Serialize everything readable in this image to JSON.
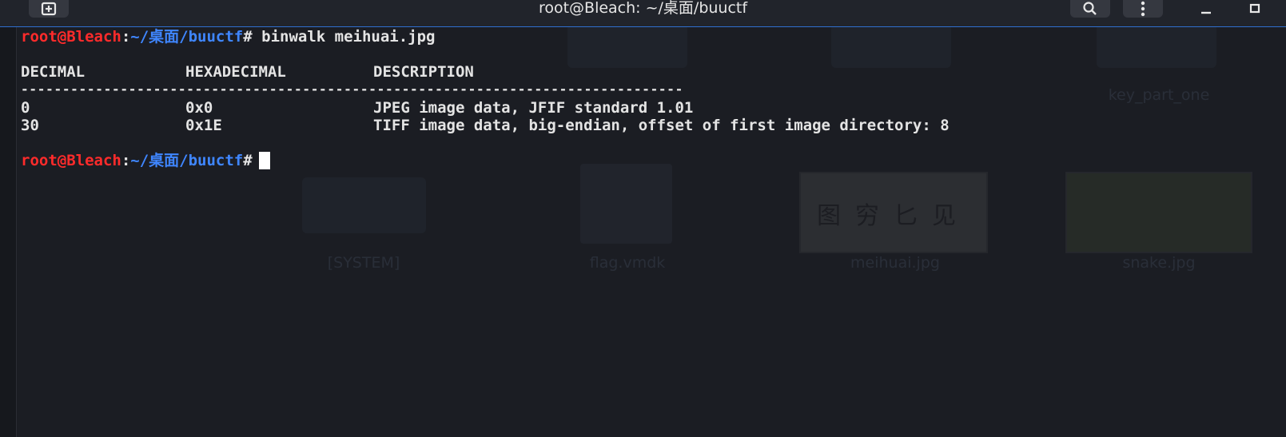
{
  "window": {
    "title": "root@Bleach: ~/桌面/buuctf"
  },
  "titlebar": {
    "new_tab_icon": "new-tab-icon",
    "search_icon": "search-icon",
    "menu_icon": "kebab-menu-icon",
    "minimize_icon": "minimize-icon",
    "maximize_icon": "maximize-icon"
  },
  "desktop": {
    "icons": [
      {
        "label": "[SYSTEM]"
      },
      {
        "label": "flag.vmdk"
      },
      {
        "label": "meihuai.jpg"
      },
      {
        "label": "snake.jpg"
      },
      {
        "label": "key_part_one"
      }
    ],
    "image_text": "图穷匕见"
  },
  "prompt": {
    "user": "root@Bleach",
    "colon": ":",
    "path": "~/桌面/buuctf",
    "hash": "#"
  },
  "command": " binwalk meihuai.jpg",
  "table": {
    "headers": [
      "DECIMAL",
      "HEXADECIMAL",
      "DESCRIPTION"
    ],
    "separator": "--------------------------------------------------------------------------------",
    "rows": [
      [
        "0",
        "0x0",
        "JPEG image data, JFIF standard 1.01"
      ],
      [
        "30",
        "0x1E",
        "TIFF image data, big-endian, offset of first image directory: 8"
      ]
    ]
  },
  "colors": {
    "background": "#1b1d23",
    "prompt_user": "#ff2b2b",
    "prompt_path": "#3f86ff",
    "text": "#e4e4e4",
    "accent_border": "#2f6fcf"
  }
}
